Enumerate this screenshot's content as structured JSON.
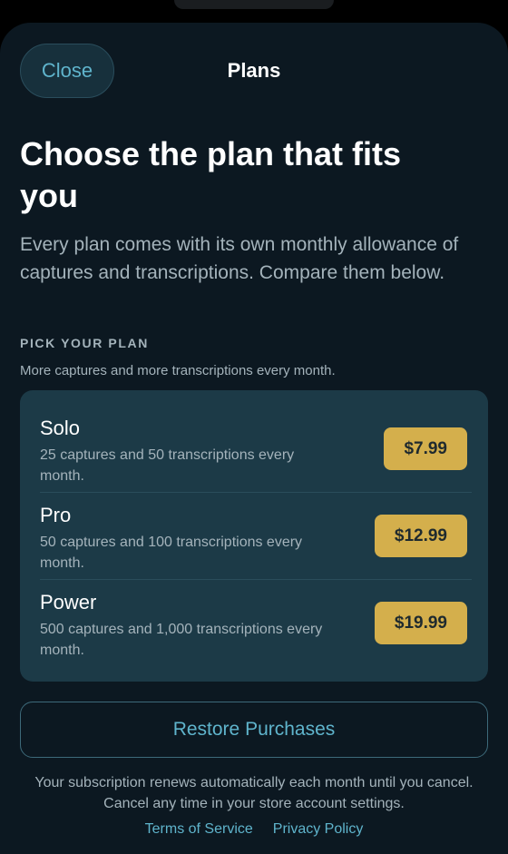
{
  "nav": {
    "close_label": "Close",
    "title": "Plans"
  },
  "header": {
    "headline": "Choose the plan that fits you",
    "intro": "Every plan comes with its own monthly allowance of captures and transcriptions. Compare them below."
  },
  "section": {
    "label": "PICK YOUR PLAN",
    "subtitle": "More captures and more transcriptions every month."
  },
  "plans": [
    {
      "name": "Solo",
      "description": "25 captures and 50 transcriptions every month.",
      "price": "$7.99"
    },
    {
      "name": "Pro",
      "description": "50 captures and 100 transcriptions every month.",
      "price": "$12.99"
    },
    {
      "name": "Power",
      "description": "500 captures and 1,000 transcriptions every month.",
      "price": "$19.99"
    }
  ],
  "restore_label": "Restore Purchases",
  "footnote": "Your subscription renews automatically each month until you cancel. Cancel any time in your store account settings.",
  "links": {
    "terms": "Terms of Service",
    "privacy": "Privacy Policy"
  },
  "colors": {
    "background": "#0c1821",
    "card": "#1c3a47",
    "accent": "#5fb4cc",
    "price": "#d4af4c"
  }
}
